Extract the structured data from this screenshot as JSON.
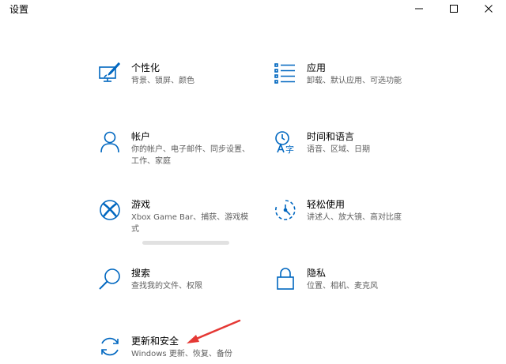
{
  "window": {
    "title": "设置",
    "controls": [
      "minimize-icon",
      "maximize-icon",
      "close-icon"
    ]
  },
  "colors": {
    "accent": "#0067c0",
    "annotation": "#e53935",
    "description": "#5f5f5f"
  },
  "settings": [
    {
      "title": "个性化",
      "desc": "背景、锁屏、颜色",
      "icon": "personalization-icon"
    },
    {
      "title": "应用",
      "desc": "卸载、默认应用、可选功能",
      "icon": "apps-icon"
    },
    {
      "title": "帐户",
      "desc": "你的帐户、电子邮件、同步设置、工作、家庭",
      "icon": "account-icon"
    },
    {
      "title": "时间和语言",
      "desc": "语音、区域、日期",
      "icon": "time-language-icon"
    },
    {
      "title": "游戏",
      "desc": "Xbox Game Bar、捕获、游戏模式",
      "icon": "xbox-icon"
    },
    {
      "title": "轻松使用",
      "desc": "讲述人、放大镜、高对比度",
      "icon": "ease-of-access-icon"
    },
    {
      "title": "搜索",
      "desc": "查找我的文件、权限",
      "icon": "search-icon"
    },
    {
      "title": "隐私",
      "desc": "位置、相机、麦克风",
      "icon": "lock-icon"
    },
    {
      "title": "更新和安全",
      "desc": "Windows 更新、恢复、备份",
      "icon": "update-icon"
    }
  ]
}
